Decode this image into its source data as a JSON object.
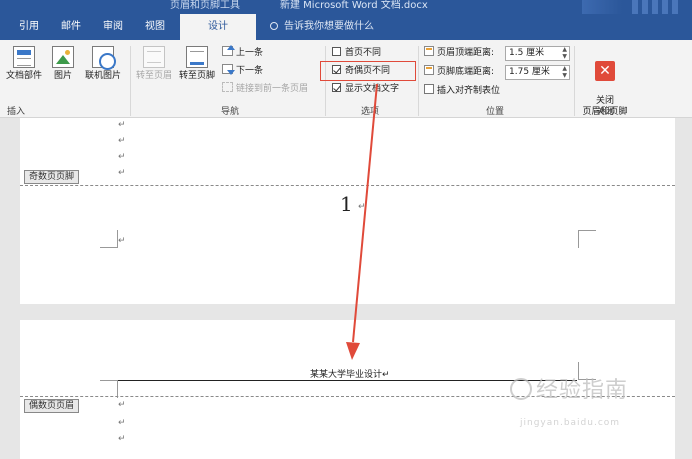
{
  "title": {
    "context_tab": "页眉和页脚工具",
    "document": "新建 Microsoft Word 文档.docx"
  },
  "tabs": [
    {
      "label": "引用"
    },
    {
      "label": "邮件"
    },
    {
      "label": "审阅"
    },
    {
      "label": "视图"
    },
    {
      "label": "设计"
    }
  ],
  "tell_me": {
    "placeholder": "告诉我你想要做什么"
  },
  "ribbon": {
    "insert": {
      "group": "插入",
      "doc_parts": "文档部件",
      "picture": "图片",
      "online_picture": "联机图片"
    },
    "nav": {
      "group": "导航",
      "goto_header": "转至页眉",
      "goto_footer": "转至页脚",
      "previous": "上一条",
      "next": "下一条",
      "link_prev": "链接到前一条页眉"
    },
    "options": {
      "group": "选项",
      "diff_first": {
        "label": "首页不同",
        "checked": false
      },
      "diff_odd_even": {
        "label": "奇偶页不同",
        "checked": true
      },
      "show_text": {
        "label": "显示文档文字",
        "checked": true
      }
    },
    "position": {
      "group": "位置",
      "header_top_label": "页眉顶端距离:",
      "header_top_value": "1.5 厘米",
      "footer_bottom_label": "页脚底端距离:",
      "footer_bottom_value": "1.75 厘米",
      "insert_align_tab": "插入对齐制表位"
    },
    "close": {
      "group": "关闭",
      "button": "关闭\n页眉和页脚"
    }
  },
  "document": {
    "page1": {
      "footer_tag": "奇数页页脚",
      "page_number": "1"
    },
    "page2": {
      "header_text": "某某大学毕业设计",
      "header_tag": "偶数页页眉"
    },
    "para_mark": "↵"
  },
  "watermark": {
    "text": "经验指南",
    "sub": "jingyan.baidu.com"
  },
  "colors": {
    "ribbon_blue": "#2b579a",
    "highlight_red": "#e04a3a"
  }
}
